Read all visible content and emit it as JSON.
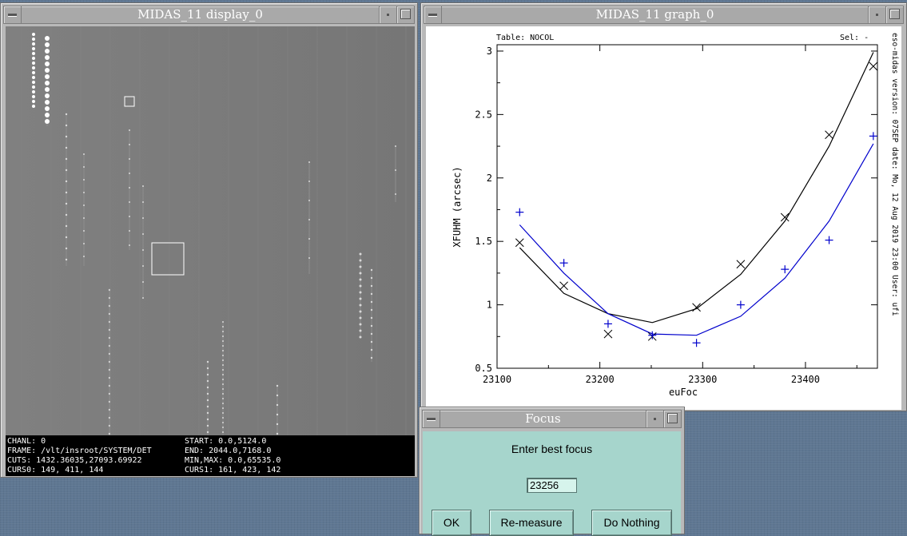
{
  "display_window": {
    "title": "MIDAS_11 display_0",
    "status": {
      "chanl": "CHANL: 0",
      "frame": "FRAME: /vlt/insroot/SYSTEM/DET",
      "cuts": "CUTS: 1432.36035,27093.69922",
      "curs0": "CURS0:  149, 411, 144",
      "start": "START: 0.0,5124.0",
      "end": "END: 2044.0,7168.0",
      "minmax": "MIN,MAX: 0.0,65535.0",
      "curs1": "CURS1:  161, 423, 142"
    }
  },
  "graph_window": {
    "title": "MIDAS_11 graph_0",
    "table_label": "Table: NOCOL",
    "sel_label": "Sel: -",
    "side_text": "eso-midas version: 07SEP   date: Mo, 12 Aug 2019 23:00   User: ufi"
  },
  "chart_data": {
    "type": "scatter",
    "xlabel": "euFoc",
    "ylabel": "XFUHM (arcsec)",
    "xlim": [
      23100,
      23470
    ],
    "ylim": [
      0.5,
      3.05
    ],
    "x_ticks": [
      23100,
      23200,
      23300,
      23400
    ],
    "x_tick_labels": [
      "23100",
      "23200",
      "23300",
      "23400"
    ],
    "y_ticks": [
      0.5,
      1,
      1.5,
      2,
      2.5,
      3
    ],
    "y_tick_labels": [
      "0.5",
      "1",
      "1.5",
      "2",
      "2.5",
      "3"
    ],
    "series": [
      {
        "marker": "x",
        "color": "#000000",
        "x": [
          23122,
          23165,
          23208,
          23251,
          23294,
          23337,
          23380,
          23423,
          23466
        ],
        "y": [
          1.49,
          1.15,
          0.77,
          0.75,
          0.98,
          1.32,
          1.69,
          2.34,
          2.88
        ],
        "fit_y": [
          1.45,
          1.09,
          0.93,
          0.86,
          0.97,
          1.24,
          1.66,
          2.25,
          2.99
        ]
      },
      {
        "marker": "+",
        "color": "#0000cc",
        "x": [
          23122,
          23165,
          23208,
          23251,
          23294,
          23337,
          23380,
          23423,
          23466
        ],
        "y": [
          1.73,
          1.33,
          0.85,
          0.76,
          0.7,
          1.0,
          1.28,
          1.51,
          2.33
        ],
        "fit_y": [
          1.63,
          1.25,
          0.93,
          0.77,
          0.76,
          0.91,
          1.21,
          1.66,
          2.27
        ]
      }
    ]
  },
  "focus_dialog": {
    "title": "Focus",
    "prompt": "Enter best focus",
    "value": "23256",
    "buttons": {
      "ok": "OK",
      "remeasure": "Re-measure",
      "nothing": "Do Nothing"
    }
  }
}
